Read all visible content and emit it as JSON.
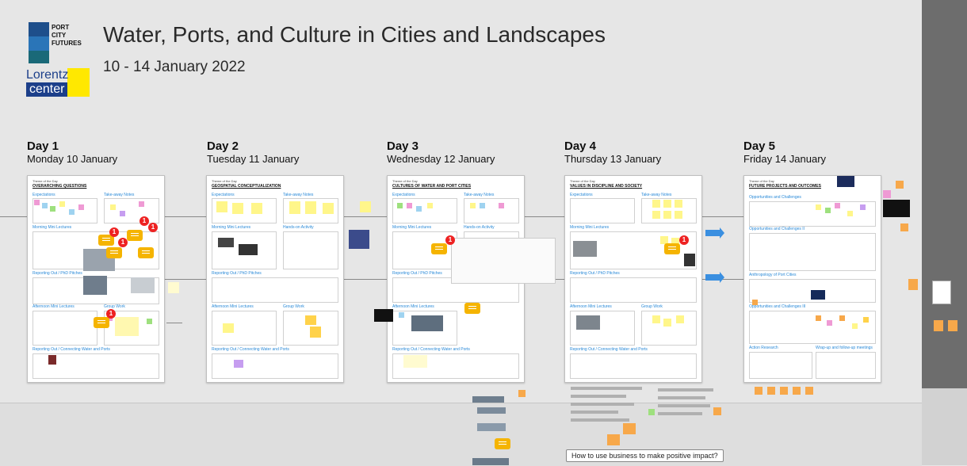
{
  "header": {
    "title": "Water, Ports, and Culture in Cities and Landscapes",
    "dates": "10 - 14 January 2022"
  },
  "logos": {
    "port_city_futures": [
      "PORT",
      "CITY",
      "FUTURES"
    ],
    "lorentz_line1": "Lorentz",
    "lorentz_line2": "center"
  },
  "days": [
    {
      "label": "Day 1",
      "date": "Monday 10 January",
      "theme": "OVERARCHING QUESTIONS",
      "sections": [
        "Expectations",
        "Take-away Notes",
        "Morning Mini Lectures",
        "Reporting Out / PhD Pitches",
        "Afternoon Mini Lectures",
        "Group Work",
        "Reporting Out / Connecting Water and Ports"
      ]
    },
    {
      "label": "Day 2",
      "date": "Tuesday 11 January",
      "theme": "GEOSPATIAL CONCEPTUALIZATION",
      "sections": [
        "Expectations",
        "Take-away Notes",
        "Morning Mini Lectures",
        "Hands-on Activity",
        "Reporting Out / PhD Pitches",
        "Afternoon Mini Lectures",
        "Group Work",
        "Reporting Out / Connecting Water and Ports"
      ]
    },
    {
      "label": "Day 3",
      "date": "Wednesday 12 January",
      "theme": "CULTURES OF WATER AND PORT CITIES",
      "sections": [
        "Expectations",
        "Take-away Notes",
        "Morning Mini Lectures",
        "Hands-on Activity",
        "Reporting Out / PhD Pitches",
        "Afternoon Mini Lectures",
        "Reporting Out / Connecting Water and Ports"
      ]
    },
    {
      "label": "Day 4",
      "date": "Thursday 13 January",
      "theme": "VALUES IN DISCIPLINE AND SOCIETY",
      "sections": [
        "Expectations",
        "Take-away Notes",
        "Morning Mini Lectures",
        "Reporting Out / PhD Pitches",
        "Afternoon Mini Lectures",
        "Group Work",
        "Reporting Out / Connecting Water and Ports"
      ]
    },
    {
      "label": "Day 5",
      "date": "Friday 14 January",
      "theme": "FUTURE PROJECTS AND OUTCOMES",
      "sections": [
        "Opportunities and Challenges",
        "Opportunities and Challenges II",
        "Anthropology of Port Cities",
        "Opportunities and Challenges III",
        "Action Research",
        "Wrap-up and follow-up meetings"
      ]
    }
  ],
  "theme_label": "Theme of the Day",
  "comment_badges": [
    "1",
    "1",
    "1",
    "1",
    "1",
    "1",
    "1",
    "1"
  ],
  "question": "How to use business to make positive impact?",
  "colors": {
    "wall": "#e6e6e6",
    "side_wall": "#6d6d6d",
    "accent_blue": "#2a8ad8",
    "badge_red": "#e22222",
    "comment_yellow": "#f5b400"
  }
}
